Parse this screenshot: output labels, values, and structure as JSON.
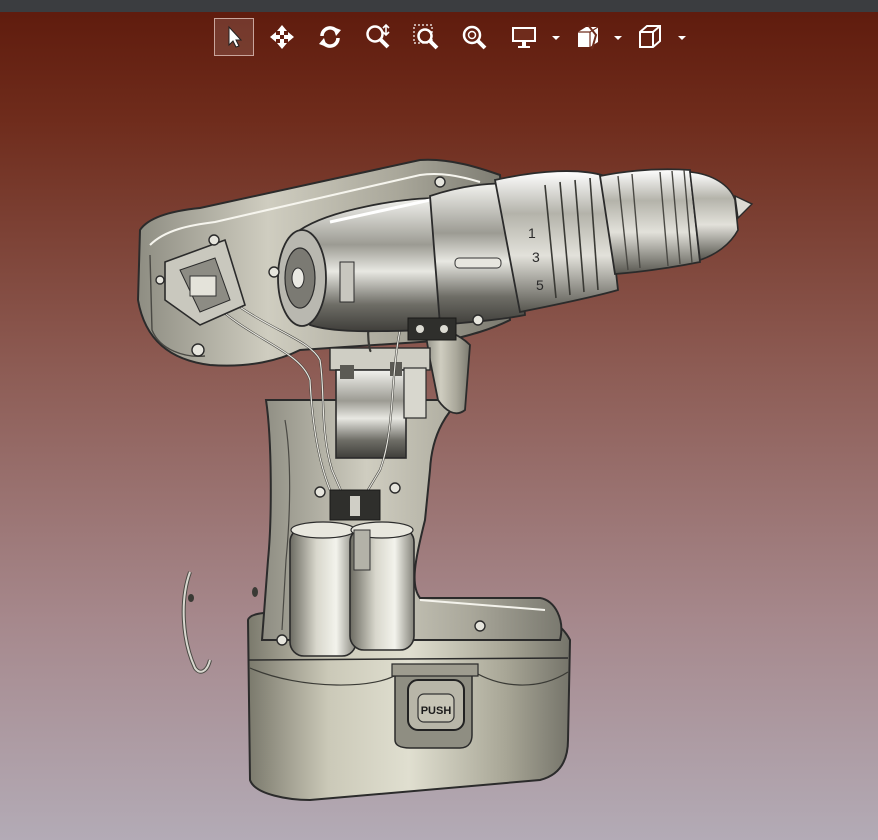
{
  "toolbar": {
    "tools": [
      {
        "id": "select",
        "icon": "arrow-pointer-icon",
        "active": true
      },
      {
        "id": "pan",
        "icon": "move-arrows-icon",
        "active": false
      },
      {
        "id": "rotate",
        "icon": "rotate-icon",
        "active": false
      },
      {
        "id": "zoom-dynamic",
        "icon": "zoom-dynamic-icon",
        "active": false
      },
      {
        "id": "zoom-window",
        "icon": "zoom-window-icon",
        "active": false
      },
      {
        "id": "zoom-fit",
        "icon": "zoom-fit-icon",
        "active": false
      },
      {
        "id": "display-mode",
        "icon": "monitor-icon",
        "dropdown": true
      },
      {
        "id": "section-view",
        "icon": "section-box-icon",
        "dropdown": true
      },
      {
        "id": "view-orientation",
        "icon": "cube-icon",
        "dropdown": true
      }
    ],
    "colors": {
      "icon": "#ffffff",
      "active_border": "#c9a59c"
    }
  },
  "model": {
    "name": "cordless-drill-cutaway",
    "button_label": "PUSH",
    "dial_labels": [
      "1",
      "3",
      "5"
    ],
    "colors": {
      "shell": "#b8b6a8",
      "shell_dark": "#6b6a60",
      "metal": "#d9d9d2",
      "edge": "#2b2b2b"
    }
  },
  "background": {
    "top": "#5e1a0c",
    "bottom": "#b3abb6"
  }
}
